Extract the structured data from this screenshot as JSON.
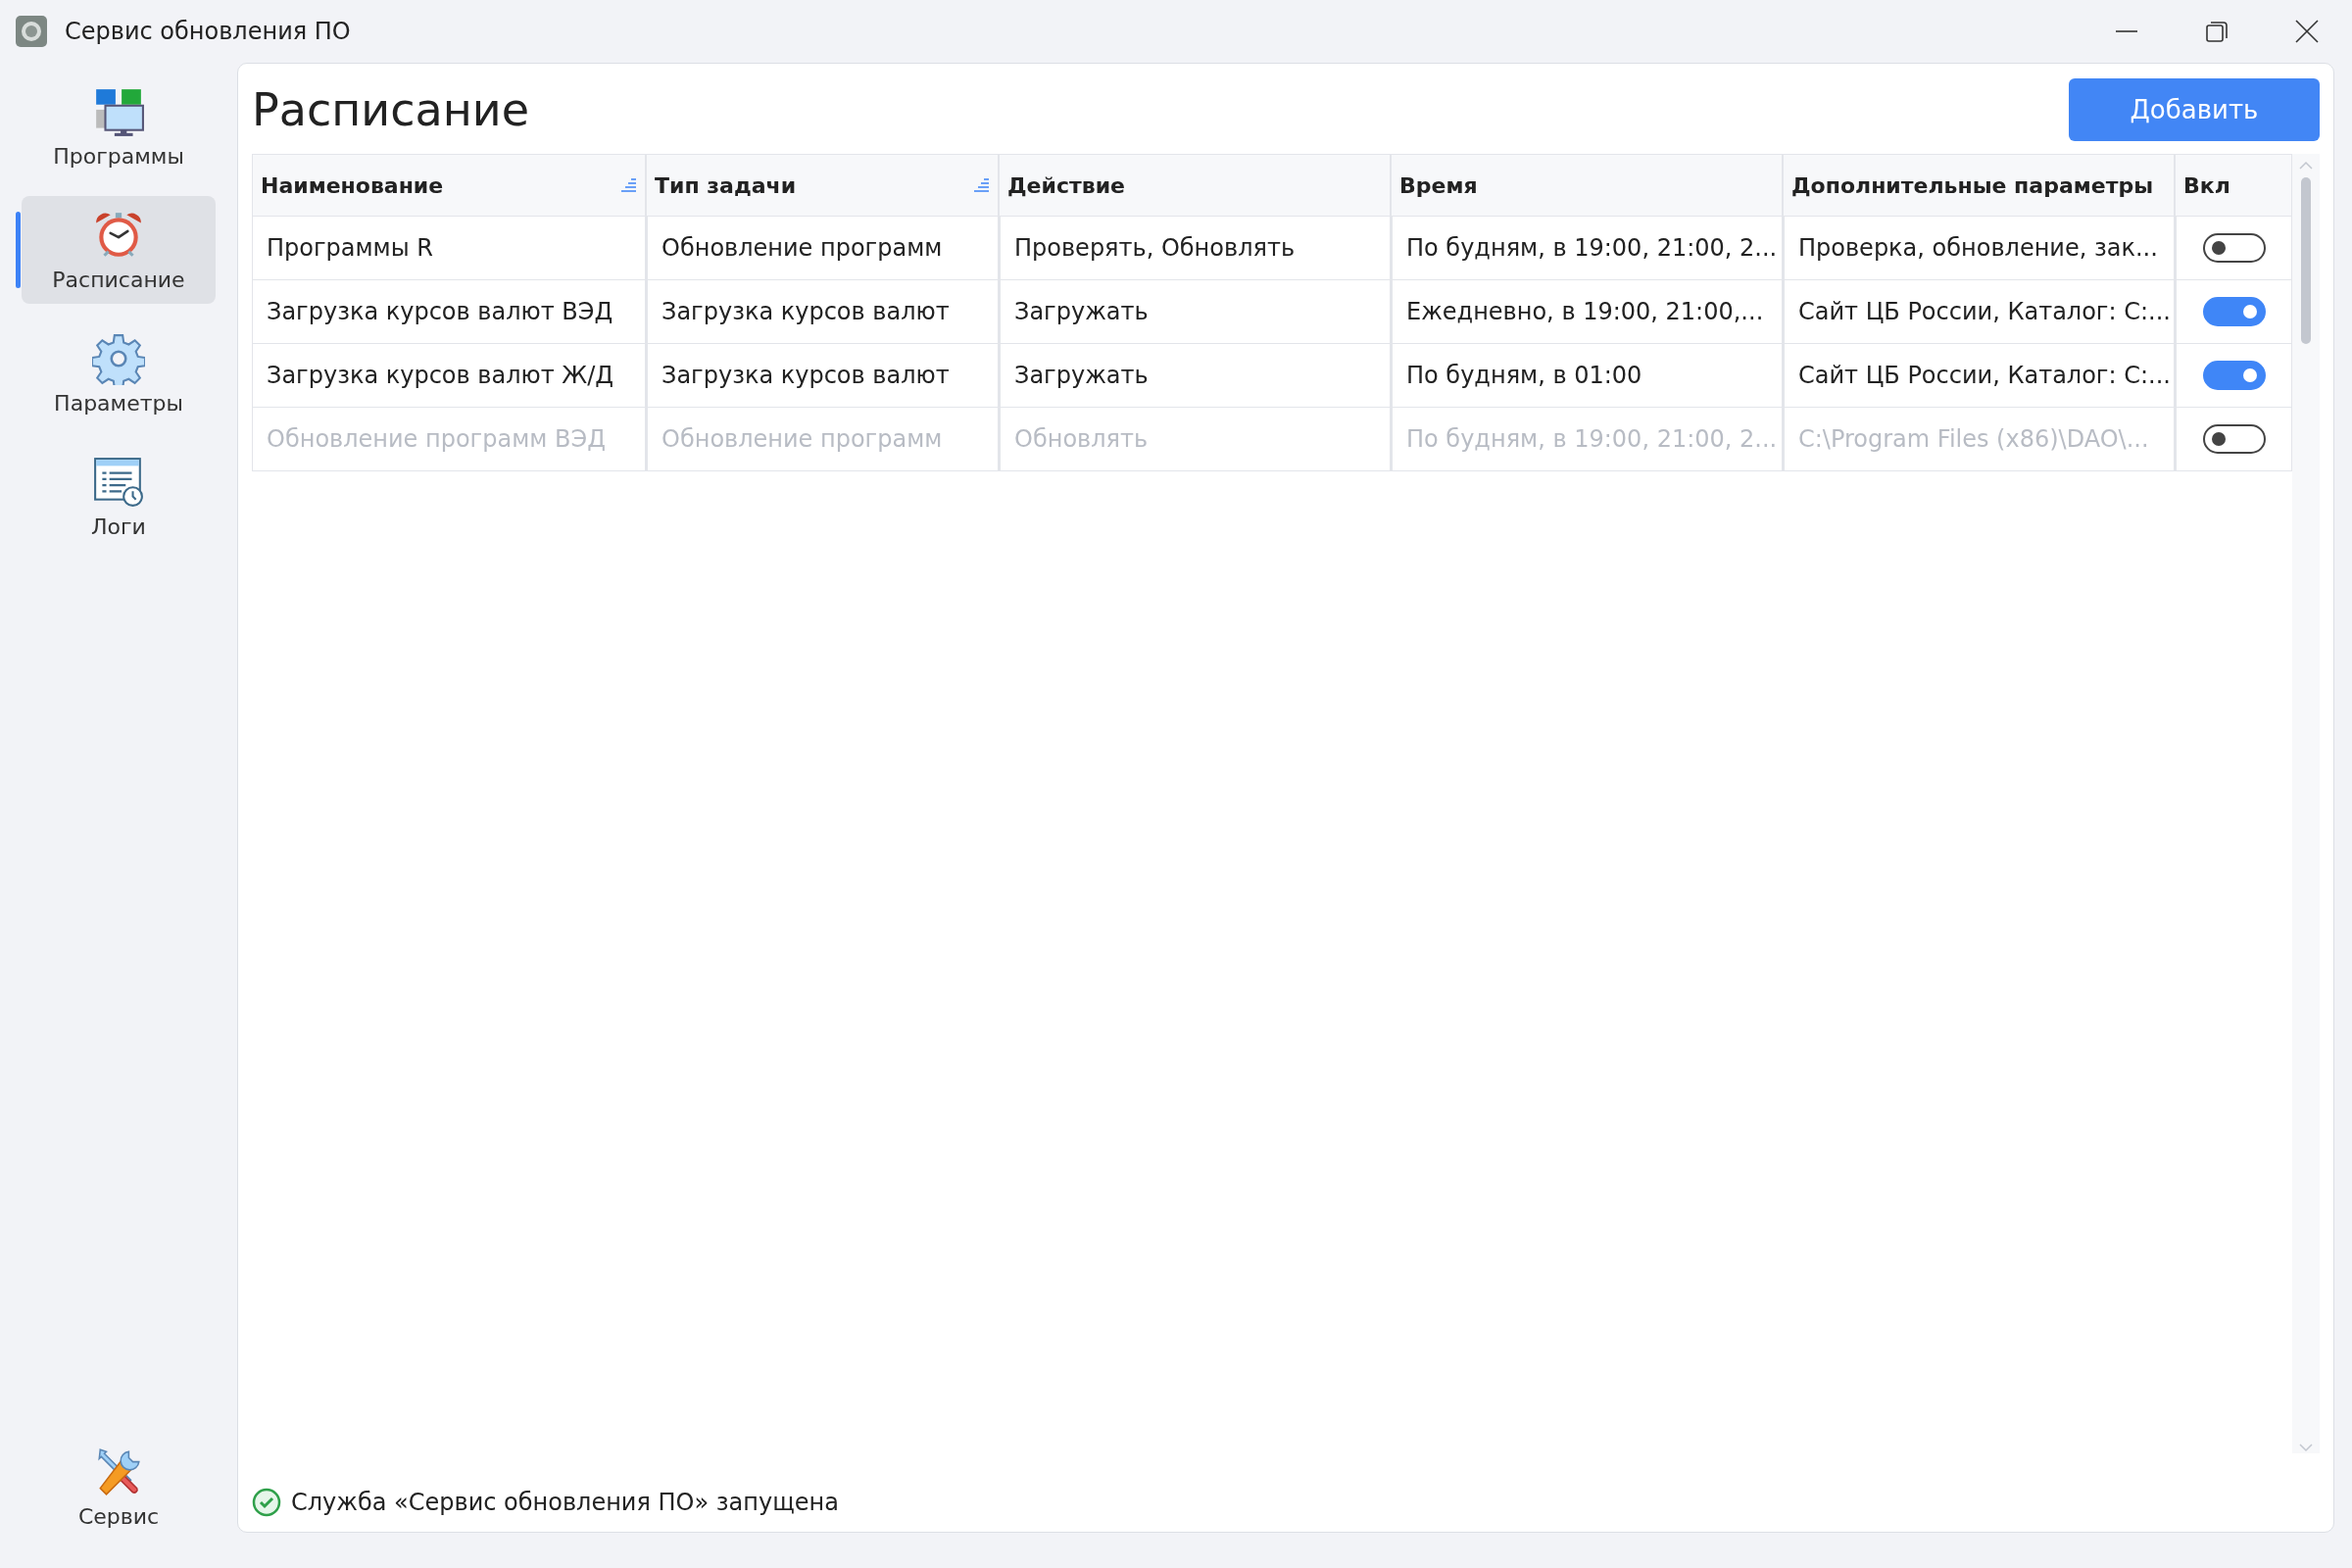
{
  "window": {
    "title": "Сервис обновления ПО"
  },
  "sidebar": {
    "items": [
      {
        "label": "Программы",
        "selected": false
      },
      {
        "label": "Расписание",
        "selected": true
      },
      {
        "label": "Параметры",
        "selected": false
      },
      {
        "label": "Логи",
        "selected": false
      }
    ],
    "bottom_item": {
      "label": "Сервис",
      "selected": false
    }
  },
  "page": {
    "title": "Расписание",
    "add_button": "Добавить"
  },
  "table": {
    "columns": [
      {
        "label": "Наименование",
        "sorted": true
      },
      {
        "label": "Тип задачи",
        "sorted": true
      },
      {
        "label": "Действие",
        "sorted": false
      },
      {
        "label": "Время",
        "sorted": false
      },
      {
        "label": "Дополнительные параметры",
        "sorted": false
      },
      {
        "label": "Вкл",
        "sorted": false
      }
    ],
    "rows": [
      {
        "cells": [
          "Программы R",
          "Обновление программ",
          "Проверять, Обновлять",
          "По будням, в 19:00, 21:00, 2...",
          "Проверка, обновление, зак..."
        ],
        "on": false,
        "disabled": false
      },
      {
        "cells": [
          "Загрузка курсов валют ВЭД",
          "Загрузка курсов валют",
          "Загружать",
          "Ежедневно, в 19:00, 21:00,...",
          "Сайт ЦБ России, Каталог: C:..."
        ],
        "on": true,
        "disabled": false
      },
      {
        "cells": [
          "Загрузка курсов валют Ж/Д",
          "Загрузка курсов валют",
          "Загружать",
          "По будням, в 01:00",
          "Сайт ЦБ России, Каталог: C:..."
        ],
        "on": true,
        "disabled": false
      },
      {
        "cells": [
          "Обновление программ ВЭД",
          "Обновление программ",
          "Обновлять",
          "По будням, в 19:00, 21:00, 2...",
          "C:\\Program Files (x86)\\DAO\\..."
        ],
        "on": false,
        "disabled": true
      }
    ]
  },
  "status_bar": {
    "text": "Служба «Сервис обновления ПО» запущена",
    "ok": true
  }
}
